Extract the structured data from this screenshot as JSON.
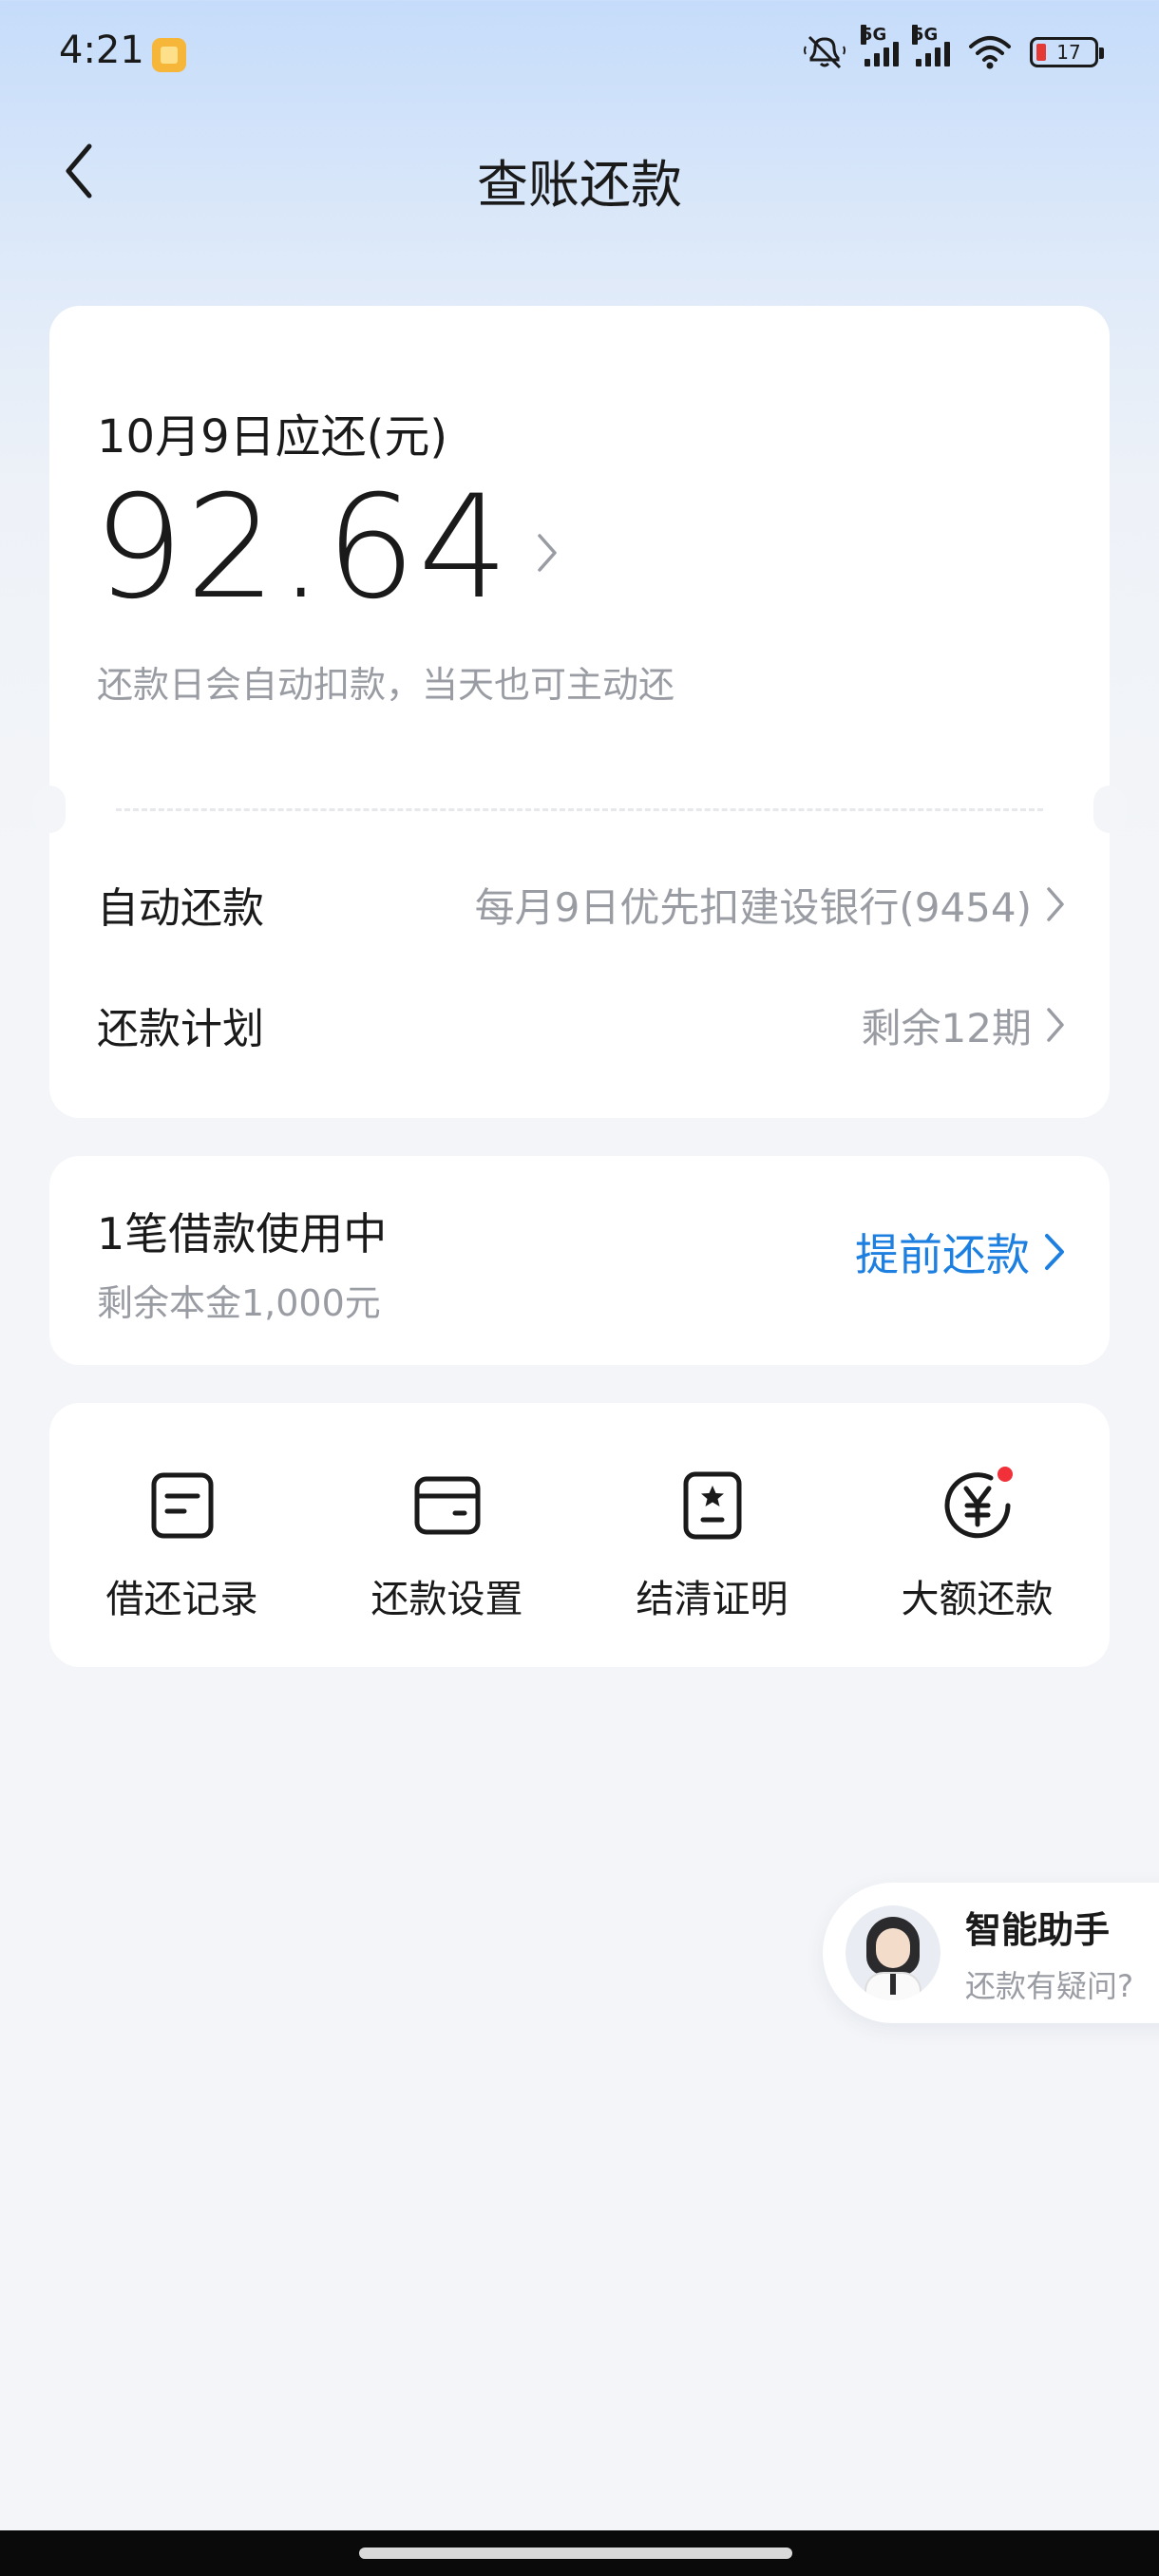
{
  "status_bar": {
    "time": "4:21",
    "network_1": "5G",
    "network_2": "5G",
    "battery": "17"
  },
  "header": {
    "title": "查账还款"
  },
  "bill": {
    "due_label": "10月9日应还(元)",
    "amount": "92.64",
    "note": "还款日会自动扣款，当天也可主动还"
  },
  "rows": {
    "auto_label": "自动还款",
    "auto_value": "每月9日优先扣建设银行(9454)",
    "plan_label": "还款计划",
    "plan_value": "剩余12期"
  },
  "loan": {
    "title": "1笔借款使用中",
    "remaining": "剩余本金1,000元",
    "prepay_label": "提前还款"
  },
  "actions": [
    {
      "label": "借还记录",
      "icon": "record-icon"
    },
    {
      "label": "还款设置",
      "icon": "wallet-icon"
    },
    {
      "label": "结清证明",
      "icon": "certificate-icon"
    },
    {
      "label": "大额还款",
      "icon": "yuan-icon"
    }
  ],
  "assistant": {
    "title": "智能助手",
    "subtitle": "还款有疑问?"
  },
  "colors": {
    "accent": "#1d7fe0",
    "secondary_text": "#9a9ca3",
    "badge": "#f2303a"
  }
}
